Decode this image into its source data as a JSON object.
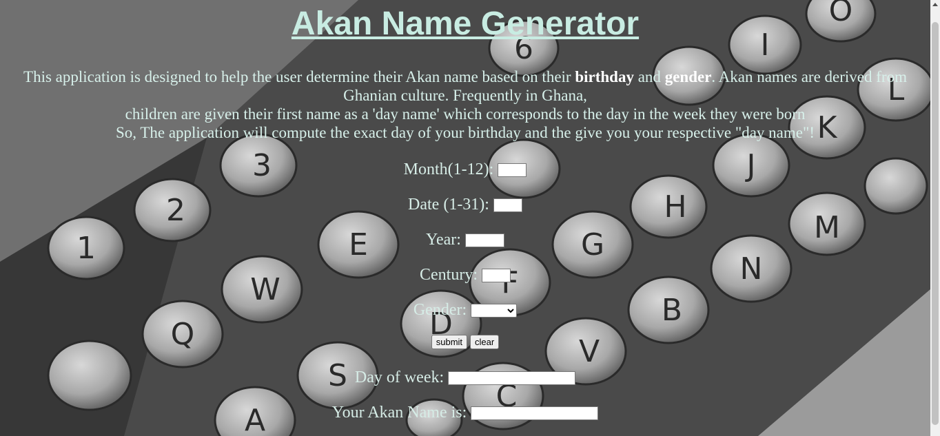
{
  "title": "Akan Name Generator",
  "intro": {
    "line1_pre": "This application is designed to help the user determine their Akan name based on their ",
    "birthday": "birthday",
    "and": " and ",
    "gender": "gender",
    "line1_post": ". Akan names are derived from Ghanian culture. Frequently in Ghana,",
    "line2": "children are given their first name as a 'day name' which corresponds to the day in the week they were born",
    "line3": "So, The application will compute the exact day of your birthday and the give you your respective \"day name\"!"
  },
  "form": {
    "month_label": "Month(1-12):",
    "month_value": "",
    "date_label": "Date (1-31):",
    "date_value": "",
    "year_label": "Year:",
    "year_value": "",
    "century_label": "Century:",
    "century_value": "",
    "gender_label": "Gender:",
    "gender_selected": "",
    "submit_label": "submit",
    "clear_label": "clear",
    "dow_label": "Day of week:",
    "dow_value": "",
    "akan_label": "Your Akan Name is:",
    "akan_value": ""
  },
  "colors": {
    "text": "#cfeee6",
    "heading": "#c8ece2"
  }
}
